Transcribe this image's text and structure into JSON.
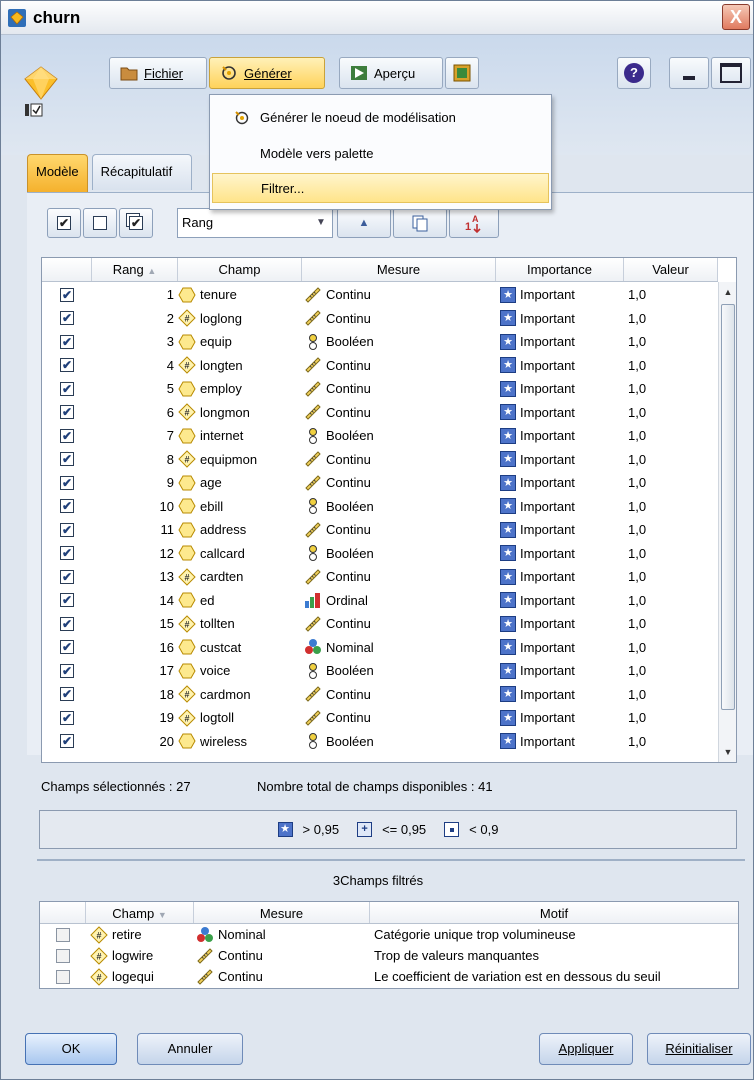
{
  "window": {
    "title": "churn",
    "close_label": "X"
  },
  "toolbar": {
    "file_label": "Fichier",
    "generate_label": "Générer",
    "preview_label": "Aperçu",
    "help_label": "?"
  },
  "generate_menu": {
    "items": [
      {
        "label": "Générer le noeud de modélisation"
      },
      {
        "label": "Modèle vers palette"
      },
      {
        "label": "Filtrer..."
      }
    ]
  },
  "tabs": [
    {
      "label": "Modèle",
      "active": true
    },
    {
      "label": "Récapitulatif",
      "active": false
    }
  ],
  "sort": {
    "value": "Rang"
  },
  "table": {
    "headers": [
      "Rang",
      "Champ",
      "Mesure",
      "Importance",
      "Valeur"
    ],
    "rows": [
      {
        "rank": "1",
        "field": "tenure",
        "ftype": "range",
        "measure": "Continu",
        "mtype": "continuous",
        "importance": "Important",
        "value": "1,0"
      },
      {
        "rank": "2",
        "field": "loglong",
        "ftype": "derived",
        "measure": "Continu",
        "mtype": "continuous",
        "importance": "Important",
        "value": "1,0"
      },
      {
        "rank": "3",
        "field": "equip",
        "ftype": "range",
        "measure": "Booléen",
        "mtype": "flag",
        "importance": "Important",
        "value": "1,0"
      },
      {
        "rank": "4",
        "field": "longten",
        "ftype": "derived",
        "measure": "Continu",
        "mtype": "continuous",
        "importance": "Important",
        "value": "1,0"
      },
      {
        "rank": "5",
        "field": "employ",
        "ftype": "range",
        "measure": "Continu",
        "mtype": "continuous",
        "importance": "Important",
        "value": "1,0"
      },
      {
        "rank": "6",
        "field": "longmon",
        "ftype": "derived",
        "measure": "Continu",
        "mtype": "continuous",
        "importance": "Important",
        "value": "1,0"
      },
      {
        "rank": "7",
        "field": "internet",
        "ftype": "range",
        "measure": "Booléen",
        "mtype": "flag",
        "importance": "Important",
        "value": "1,0"
      },
      {
        "rank": "8",
        "field": "equipmon",
        "ftype": "derived",
        "measure": "Continu",
        "mtype": "continuous",
        "importance": "Important",
        "value": "1,0"
      },
      {
        "rank": "9",
        "field": "age",
        "ftype": "range",
        "measure": "Continu",
        "mtype": "continuous",
        "importance": "Important",
        "value": "1,0"
      },
      {
        "rank": "10",
        "field": "ebill",
        "ftype": "range",
        "measure": "Booléen",
        "mtype": "flag",
        "importance": "Important",
        "value": "1,0"
      },
      {
        "rank": "11",
        "field": "address",
        "ftype": "range",
        "measure": "Continu",
        "mtype": "continuous",
        "importance": "Important",
        "value": "1,0"
      },
      {
        "rank": "12",
        "field": "callcard",
        "ftype": "range",
        "measure": "Booléen",
        "mtype": "flag",
        "importance": "Important",
        "value": "1,0"
      },
      {
        "rank": "13",
        "field": "cardten",
        "ftype": "derived",
        "measure": "Continu",
        "mtype": "continuous",
        "importance": "Important",
        "value": "1,0"
      },
      {
        "rank": "14",
        "field": "ed",
        "ftype": "range",
        "measure": "Ordinal",
        "mtype": "ordinal",
        "importance": "Important",
        "value": "1,0"
      },
      {
        "rank": "15",
        "field": "tollten",
        "ftype": "derived",
        "measure": "Continu",
        "mtype": "continuous",
        "importance": "Important",
        "value": "1,0"
      },
      {
        "rank": "16",
        "field": "custcat",
        "ftype": "range",
        "measure": "Nominal",
        "mtype": "nominal",
        "importance": "Important",
        "value": "1,0"
      },
      {
        "rank": "17",
        "field": "voice",
        "ftype": "range",
        "measure": "Booléen",
        "mtype": "flag",
        "importance": "Important",
        "value": "1,0"
      },
      {
        "rank": "18",
        "field": "cardmon",
        "ftype": "derived",
        "measure": "Continu",
        "mtype": "continuous",
        "importance": "Important",
        "value": "1,0"
      },
      {
        "rank": "19",
        "field": "logtoll",
        "ftype": "derived",
        "measure": "Continu",
        "mtype": "continuous",
        "importance": "Important",
        "value": "1,0"
      },
      {
        "rank": "20",
        "field": "wireless",
        "ftype": "range",
        "measure": "Booléen",
        "mtype": "flag",
        "importance": "Important",
        "value": "1,0"
      }
    ]
  },
  "status": {
    "selected": "Champs sélectionnés : 27",
    "total": "Nombre total de champs disponibles : 41"
  },
  "legend": {
    "important": "> 0,95",
    "marginal": "<= 0,95",
    "unimportant": "< 0,9"
  },
  "filtered": {
    "title": "3Champs filtrés",
    "headers": [
      "Champ",
      "Mesure",
      "Motif"
    ],
    "rows": [
      {
        "field": "retire",
        "measure": "Nominal",
        "mtype": "nominal",
        "reason": "Catégorie unique trop volumineuse"
      },
      {
        "field": "logwire",
        "measure": "Continu",
        "mtype": "continuous",
        "reason": "Trop de valeurs manquantes"
      },
      {
        "field": "logequi",
        "measure": "Continu",
        "mtype": "continuous",
        "reason": "Le coefficient de variation est en dessous du seuil"
      }
    ]
  },
  "buttons": {
    "ok": "OK",
    "cancel": "Annuler",
    "apply": "Appliquer",
    "reset": "Réinitialiser"
  },
  "colors": {
    "accent_tab": "#f5b12d",
    "importance_blue": "#4d73c9",
    "menu_highlight": "#ffe48a"
  }
}
